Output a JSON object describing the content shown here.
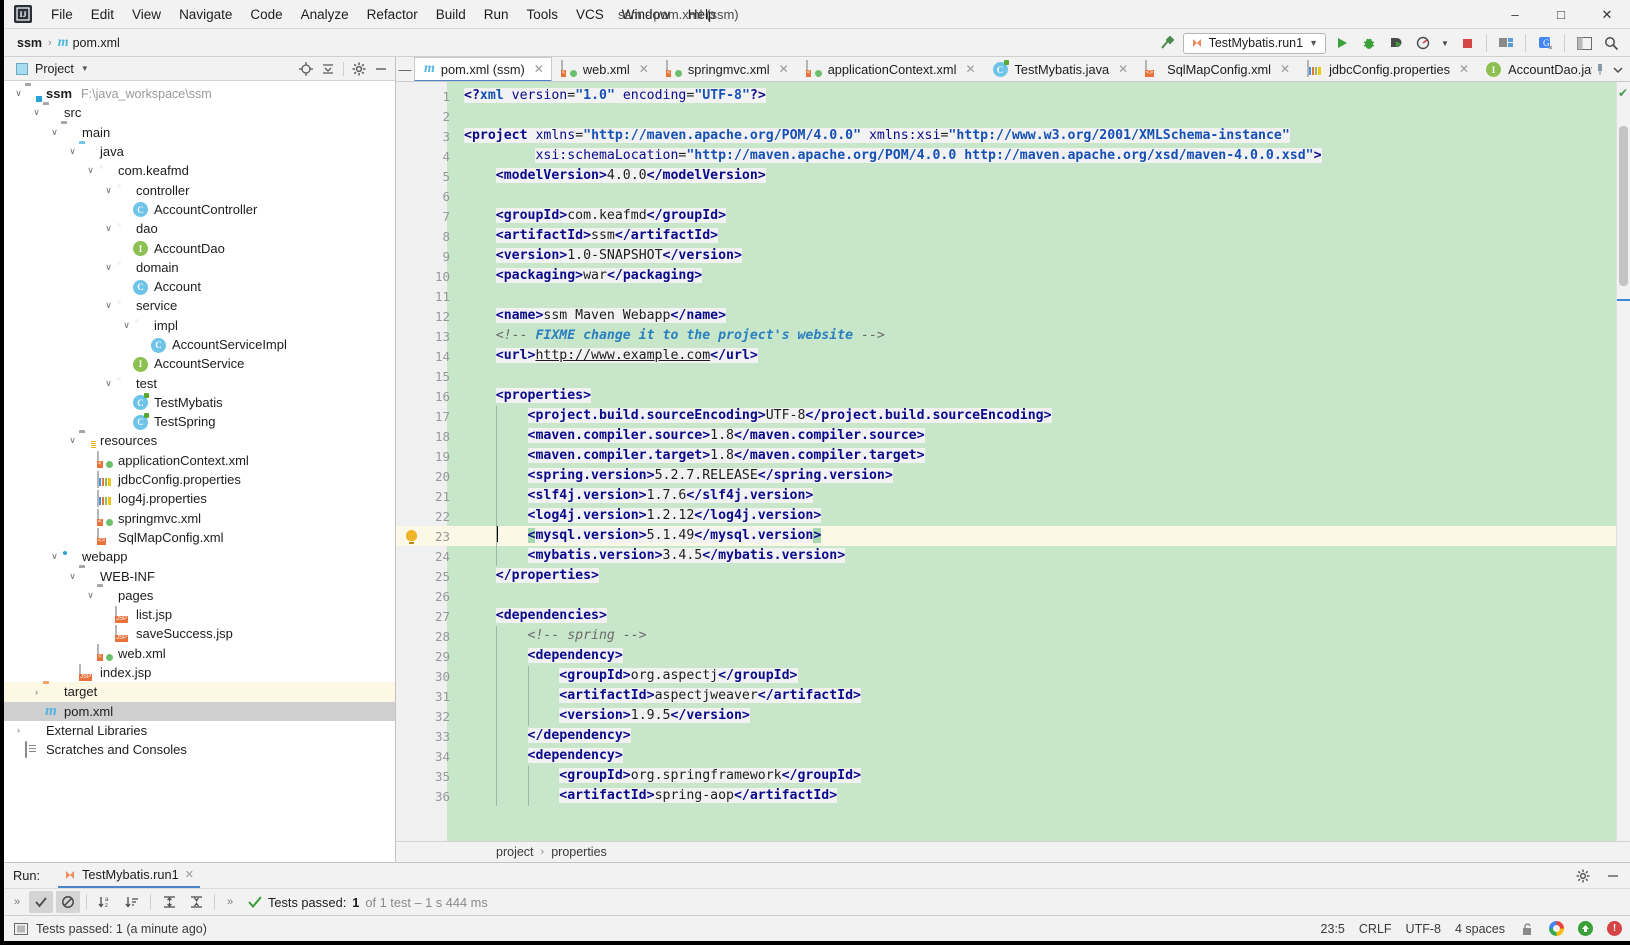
{
  "window": {
    "title": "ssm - pom.xml (ssm)",
    "minimize": "–",
    "maximize": "□",
    "close": "✕",
    "logo": "IJ"
  },
  "menu": [
    {
      "label": "File"
    },
    {
      "label": "Edit"
    },
    {
      "label": "View"
    },
    {
      "label": "Navigate"
    },
    {
      "label": "Code"
    },
    {
      "label": "Analyze"
    },
    {
      "label": "Refactor"
    },
    {
      "label": "Build"
    },
    {
      "label": "Run"
    },
    {
      "label": "Tools"
    },
    {
      "label": "VCS"
    },
    {
      "label": "Window"
    },
    {
      "label": "Help"
    }
  ],
  "navbar": {
    "crumb_project": "ssm",
    "crumb_sep": "›",
    "crumb_file": "pom.xml",
    "maven_glyph": "m",
    "run_config": "TestMybatis.run1",
    "run_config_caret": "▼",
    "icons": {
      "hammer": "build-icon",
      "run": "▶",
      "debug": "debug-icon",
      "run_coverage": "run-with-coverage-icon",
      "profiler": "profiler-icon",
      "profiler_caret": "▼",
      "stop": "■",
      "project_structure": "project-structure-icon",
      "translate": "translate-icon",
      "layout": "layout-icon",
      "search": "search-icon"
    }
  },
  "project_panel": {
    "title": "Project",
    "caret": "▼",
    "header_icons": [
      "locate-icon",
      "collapse-all-icon",
      "gear-icon",
      "hide-icon"
    ],
    "tree": [
      {
        "indent": 0,
        "arrow": "∨",
        "icon": "module-folder",
        "label": "ssm",
        "bold": true,
        "path": "F:\\java_workspace\\ssm"
      },
      {
        "indent": 1,
        "arrow": "∨",
        "icon": "folder-gray",
        "label": "src"
      },
      {
        "indent": 2,
        "arrow": "∨",
        "icon": "folder-gray",
        "label": "main"
      },
      {
        "indent": 3,
        "arrow": "∨",
        "icon": "folder-blue",
        "label": "java"
      },
      {
        "indent": 4,
        "arrow": "∨",
        "icon": "package",
        "label": "com.keafmd"
      },
      {
        "indent": 5,
        "arrow": "∨",
        "icon": "package",
        "label": "controller"
      },
      {
        "indent": 6,
        "arrow": "",
        "icon": "class",
        "label": "AccountController"
      },
      {
        "indent": 5,
        "arrow": "∨",
        "icon": "package",
        "label": "dao"
      },
      {
        "indent": 6,
        "arrow": "",
        "icon": "interface",
        "label": "AccountDao"
      },
      {
        "indent": 5,
        "arrow": "∨",
        "icon": "package",
        "label": "domain"
      },
      {
        "indent": 6,
        "arrow": "",
        "icon": "class",
        "label": "Account"
      },
      {
        "indent": 5,
        "arrow": "∨",
        "icon": "package",
        "label": "service"
      },
      {
        "indent": 6,
        "arrow": "∨",
        "icon": "package",
        "label": "impl"
      },
      {
        "indent": 7,
        "arrow": "",
        "icon": "class",
        "label": "AccountServiceImpl"
      },
      {
        "indent": 6,
        "arrow": "",
        "icon": "interface",
        "label": "AccountService"
      },
      {
        "indent": 5,
        "arrow": "∨",
        "icon": "package",
        "label": "test"
      },
      {
        "indent": 6,
        "arrow": "",
        "icon": "class-test",
        "label": "TestMybatis"
      },
      {
        "indent": 6,
        "arrow": "",
        "icon": "class-test",
        "label": "TestSpring"
      },
      {
        "indent": 3,
        "arrow": "∨",
        "icon": "folder-resources",
        "label": "resources"
      },
      {
        "indent": 4,
        "arrow": "",
        "icon": "xml-spring",
        "label": "applicationContext.xml"
      },
      {
        "indent": 4,
        "arrow": "",
        "icon": "properties",
        "label": "jdbcConfig.properties"
      },
      {
        "indent": 4,
        "arrow": "",
        "icon": "properties",
        "label": "log4j.properties"
      },
      {
        "indent": 4,
        "arrow": "",
        "icon": "xml-spring",
        "label": "springmvc.xml"
      },
      {
        "indent": 4,
        "arrow": "",
        "icon": "xml",
        "label": "SqlMapConfig.xml"
      },
      {
        "indent": 2,
        "arrow": "∨",
        "icon": "webapp",
        "label": "webapp"
      },
      {
        "indent": 3,
        "arrow": "∨",
        "icon": "folder-gray",
        "label": "WEB-INF"
      },
      {
        "indent": 4,
        "arrow": "∨",
        "icon": "folder-gray",
        "label": "pages"
      },
      {
        "indent": 5,
        "arrow": "",
        "icon": "jsp",
        "label": "list.jsp"
      },
      {
        "indent": 5,
        "arrow": "",
        "icon": "jsp",
        "label": "saveSuccess.jsp"
      },
      {
        "indent": 4,
        "arrow": "",
        "icon": "xml-spring",
        "label": "web.xml"
      },
      {
        "indent": 3,
        "arrow": "",
        "icon": "jsp",
        "label": "index.jsp"
      },
      {
        "indent": 1,
        "arrow": "›",
        "icon": "folder-orange",
        "label": "target",
        "state": "target"
      },
      {
        "indent": 1,
        "arrow": "",
        "icon": "maven",
        "label": "pom.xml",
        "state": "selected"
      },
      {
        "indent": 0,
        "arrow": "›",
        "icon": "libraries",
        "label": "External Libraries"
      },
      {
        "indent": 0,
        "arrow": "",
        "icon": "scratches",
        "label": "Scratches and Consoles"
      }
    ]
  },
  "editor": {
    "collapse_glyph": "—",
    "tabs": [
      {
        "label": "pom.xml (ssm)",
        "icon": "maven-icon",
        "active": true
      },
      {
        "label": "web.xml",
        "icon": "xml-spring-icon",
        "active": false
      },
      {
        "label": "springmvc.xml",
        "icon": "xml-spring-icon",
        "active": false
      },
      {
        "label": "applicationContext.xml",
        "icon": "xml-spring-icon",
        "active": false
      },
      {
        "label": "TestMybatis.java",
        "icon": "class-test-icon",
        "active": false
      },
      {
        "label": "SqlMapConfig.xml",
        "icon": "xml-icon",
        "active": false
      },
      {
        "label": "jdbcConfig.properties",
        "icon": "properties-icon",
        "active": false
      },
      {
        "label": "AccountDao.java",
        "icon": "interface-icon",
        "active": false
      }
    ],
    "tab_close": "✕",
    "tabbar_right": [
      "pin-icon",
      "chevron-down-icon"
    ],
    "inspection_ok": "✔",
    "breadcrumb": [
      "project",
      "properties"
    ],
    "breadcrumb_sep": "›",
    "current_line": 23,
    "lines": [
      {
        "n": 1,
        "indent": 0,
        "html": "<span class=\"tok\"><span class=\"tag\">&lt;?</span><span class=\"aval\">xml</span> <span class=\"attr\">version</span>=<span class=\"aval\">\"1.0\"</span> <span class=\"attr\">encoding</span>=<span class=\"aval\">\"UTF-8\"</span><span class=\"tag\">?&gt;</span></span>"
      },
      {
        "n": 2,
        "indent": 0,
        "html": ""
      },
      {
        "n": 3,
        "indent": 0,
        "fold": "-",
        "html": "<span class=\"tok\"><span class=\"tag\">&lt;project</span> <span class=\"attr\">xmlns</span>=<span class=\"aval\">\"http://maven.apache.org/POM/4.0.0\"</span> <span class=\"attr\">xmlns:xsi</span>=<span class=\"aval\">\"http://www.w3.org/2001/XMLSchema-instance\"</span></span>"
      },
      {
        "n": 4,
        "indent": 0,
        "html": "         <span class=\"tok\"><span class=\"attr\">xsi:schemaLocation</span>=<span class=\"aval\">\"http://maven.apache.org/POM/4.0.0 http://maven.apache.org/xsd/maven-4.0.0.xsd\"</span><span class=\"tag\">&gt;</span></span>"
      },
      {
        "n": 5,
        "indent": 0,
        "html": "    <span class=\"tok\"><span class=\"tag\">&lt;modelVersion&gt;</span><span class=\"txt\">4.0.0</span><span class=\"tag\">&lt;/modelVersion&gt;</span></span>"
      },
      {
        "n": 6,
        "indent": 0,
        "html": ""
      },
      {
        "n": 7,
        "indent": 0,
        "html": "    <span class=\"tok\"><span class=\"tag\">&lt;groupId&gt;</span><span class=\"txt\">com.keafmd</span><span class=\"tag\">&lt;/groupId&gt;</span></span>"
      },
      {
        "n": 8,
        "indent": 0,
        "html": "    <span class=\"tok\"><span class=\"tag\">&lt;artifactId&gt;</span><span class=\"txt\">ssm</span><span class=\"tag\">&lt;/artifactId&gt;</span></span>"
      },
      {
        "n": 9,
        "indent": 0,
        "html": "    <span class=\"tok\"><span class=\"tag\">&lt;version&gt;</span><span class=\"txt\">1.0-SNAPSHOT</span><span class=\"tag\">&lt;/version&gt;</span></span>"
      },
      {
        "n": 10,
        "indent": 0,
        "html": "    <span class=\"tok\"><span class=\"tag\">&lt;packaging&gt;</span><span class=\"txt\">war</span><span class=\"tag\">&lt;/packaging&gt;</span></span>"
      },
      {
        "n": 11,
        "indent": 0,
        "html": ""
      },
      {
        "n": 12,
        "indent": 0,
        "html": "    <span class=\"tok\"><span class=\"tag\">&lt;name&gt;</span><span class=\"txt\">ssm Maven Webapp</span><span class=\"tag\">&lt;/name&gt;</span></span>"
      },
      {
        "n": 13,
        "indent": 0,
        "html": "    <span class=\"cmt\">&lt;!-- </span><span class=\"cmt-fixme\">FIXME change it to the project's website</span><span class=\"cmt\"> --&gt;</span>"
      },
      {
        "n": 14,
        "indent": 0,
        "html": "    <span class=\"tok\"><span class=\"tag\">&lt;url&gt;</span><span class=\"url\">http://www.example.com</span><span class=\"tag\">&lt;/url&gt;</span></span>"
      },
      {
        "n": 15,
        "indent": 0,
        "html": ""
      },
      {
        "n": 16,
        "indent": 0,
        "fold": "-",
        "html": "    <span class=\"tok\"><span class=\"tag\">&lt;properties&gt;</span></span>"
      },
      {
        "n": 17,
        "indent": 1,
        "html": "        <span class=\"tok\"><span class=\"tag\">&lt;project.build.sourceEncoding&gt;</span><span class=\"txt\">UTF-8</span><span class=\"tag\">&lt;/project.build.sourceEncoding&gt;</span></span>"
      },
      {
        "n": 18,
        "indent": 1,
        "html": "        <span class=\"tok\"><span class=\"tag\">&lt;maven.compiler.source&gt;</span><span class=\"txt\">1.8</span><span class=\"tag\">&lt;/maven.compiler.source&gt;</span></span>"
      },
      {
        "n": 19,
        "indent": 1,
        "html": "        <span class=\"tok\"><span class=\"tag\">&lt;maven.compiler.target&gt;</span><span class=\"txt\">1.8</span><span class=\"tag\">&lt;/maven.compiler.target&gt;</span></span>"
      },
      {
        "n": 20,
        "indent": 1,
        "html": "        <span class=\"tok\"><span class=\"tag\">&lt;spring.version&gt;</span><span class=\"txt\">5.2.7.RELEASE</span><span class=\"tag\">&lt;/spring.version&gt;</span></span>"
      },
      {
        "n": 21,
        "indent": 1,
        "html": "        <span class=\"tok\"><span class=\"tag\">&lt;slf4j.version&gt;</span><span class=\"txt\">1.7.6</span><span class=\"tag\">&lt;/slf4j.version&gt;</span></span>"
      },
      {
        "n": 22,
        "indent": 1,
        "html": "        <span class=\"tok\"><span class=\"tag\">&lt;log4j.version&gt;</span><span class=\"txt\">1.2.12</span><span class=\"tag\">&lt;/log4j.version&gt;</span></span>"
      },
      {
        "n": 23,
        "indent": 1,
        "cur": true,
        "bulb": true,
        "html": "    <span class=\"caret\"></span>    <span class=\"sel-bg\"><span class=\"tag\">&lt;</span></span><span class=\"tok\"><span class=\"tag\">mysql.version&gt;</span><span class=\"txt\">5.1.49</span><span class=\"tag\">&lt;/mysql.version</span></span><span class=\"sel-bg\"><span class=\"tag\">&gt;</span></span>"
      },
      {
        "n": 24,
        "indent": 1,
        "html": "        <span class=\"tok\"><span class=\"tag\">&lt;mybatis.version&gt;</span><span class=\"txt\">3.4.5</span><span class=\"tag\">&lt;/mybatis.version&gt;</span></span>"
      },
      {
        "n": 25,
        "indent": 0,
        "fold": "+",
        "html": "    <span class=\"tok\"><span class=\"tag\">&lt;/properties&gt;</span></span>"
      },
      {
        "n": 26,
        "indent": 0,
        "html": ""
      },
      {
        "n": 27,
        "indent": 0,
        "fold": "-",
        "html": "    <span class=\"tok\"><span class=\"tag\">&lt;dependencies&gt;</span></span>"
      },
      {
        "n": 28,
        "indent": 1,
        "html": "        <span class=\"cmt\">&lt;!-- spring --&gt;</span>"
      },
      {
        "n": 29,
        "indent": 1,
        "fold": "-",
        "html": "        <span class=\"tok\"><span class=\"tag\">&lt;dependency&gt;</span></span>"
      },
      {
        "n": 30,
        "indent": 2,
        "html": "            <span class=\"tok\"><span class=\"tag\">&lt;groupId&gt;</span><span class=\"txt\">org.aspectj</span><span class=\"tag\">&lt;/groupId&gt;</span></span>"
      },
      {
        "n": 31,
        "indent": 2,
        "html": "            <span class=\"tok\"><span class=\"tag\">&lt;artifactId&gt;</span><span class=\"txt\">aspectjweaver</span><span class=\"tag\">&lt;/artifactId&gt;</span></span>"
      },
      {
        "n": 32,
        "indent": 2,
        "html": "            <span class=\"tok\"><span class=\"tag\">&lt;version&gt;</span><span class=\"txt\">1.9.5</span><span class=\"tag\">&lt;/version&gt;</span></span>"
      },
      {
        "n": 33,
        "indent": 1,
        "fold": "+",
        "html": "        <span class=\"tok\"><span class=\"tag\">&lt;/dependency&gt;</span></span>"
      },
      {
        "n": 34,
        "indent": 1,
        "fold": "-",
        "html": "        <span class=\"tok\"><span class=\"tag\">&lt;dependency&gt;</span></span>"
      },
      {
        "n": 35,
        "indent": 2,
        "html": "            <span class=\"tok\"><span class=\"tag\">&lt;groupId&gt;</span><span class=\"txt\">org.springframework</span><span class=\"tag\">&lt;/groupId&gt;</span></span>"
      },
      {
        "n": 36,
        "indent": 2,
        "html": "            <span class=\"tok\"><span class=\"tag\">&lt;artifactId&gt;</span><span class=\"txt\">spring-aop</span><span class=\"tag\">&lt;/artifactId&gt;</span></span>"
      }
    ]
  },
  "run_panel": {
    "label": "Run:",
    "tab": "TestMybatis.run1",
    "tab_close": "✕",
    "gear": "gear-icon",
    "hide": "—",
    "toolbar": {
      "expand": "»",
      "ok_filter": "✔",
      "ignored_filter": "⊘",
      "sort_alpha": "sort-alphabetically-icon",
      "sort_duration": "sort-by-duration-icon",
      "expand_all": "expand-all-icon",
      "collapse_all": "collapse-all-icon",
      "more": "»"
    },
    "status_check": "✔",
    "status_label": "Tests passed:",
    "status_count": "1",
    "status_detail": "of 1 test – 1 s 444 ms"
  },
  "statusbar": {
    "left_icon": "event-log-icon",
    "message": "Tests passed: 1 (a minute ago)",
    "caret_position": "23:5",
    "line_separator": "CRLF",
    "encoding": "UTF-8",
    "indent": "4 spaces",
    "lock_icon": "🔓",
    "google_icon": "google-translate-icon",
    "update_icon": "↑",
    "error_icon": "!"
  },
  "colors": {
    "accent_blue": "#4a86c8",
    "diff_green": "#c8e6c9",
    "current_line_yellow": "#fcf8e8",
    "tag_blue": "#0a0a8c",
    "value_blue": "#1551b5",
    "selection_green": "#a8d8b0"
  }
}
